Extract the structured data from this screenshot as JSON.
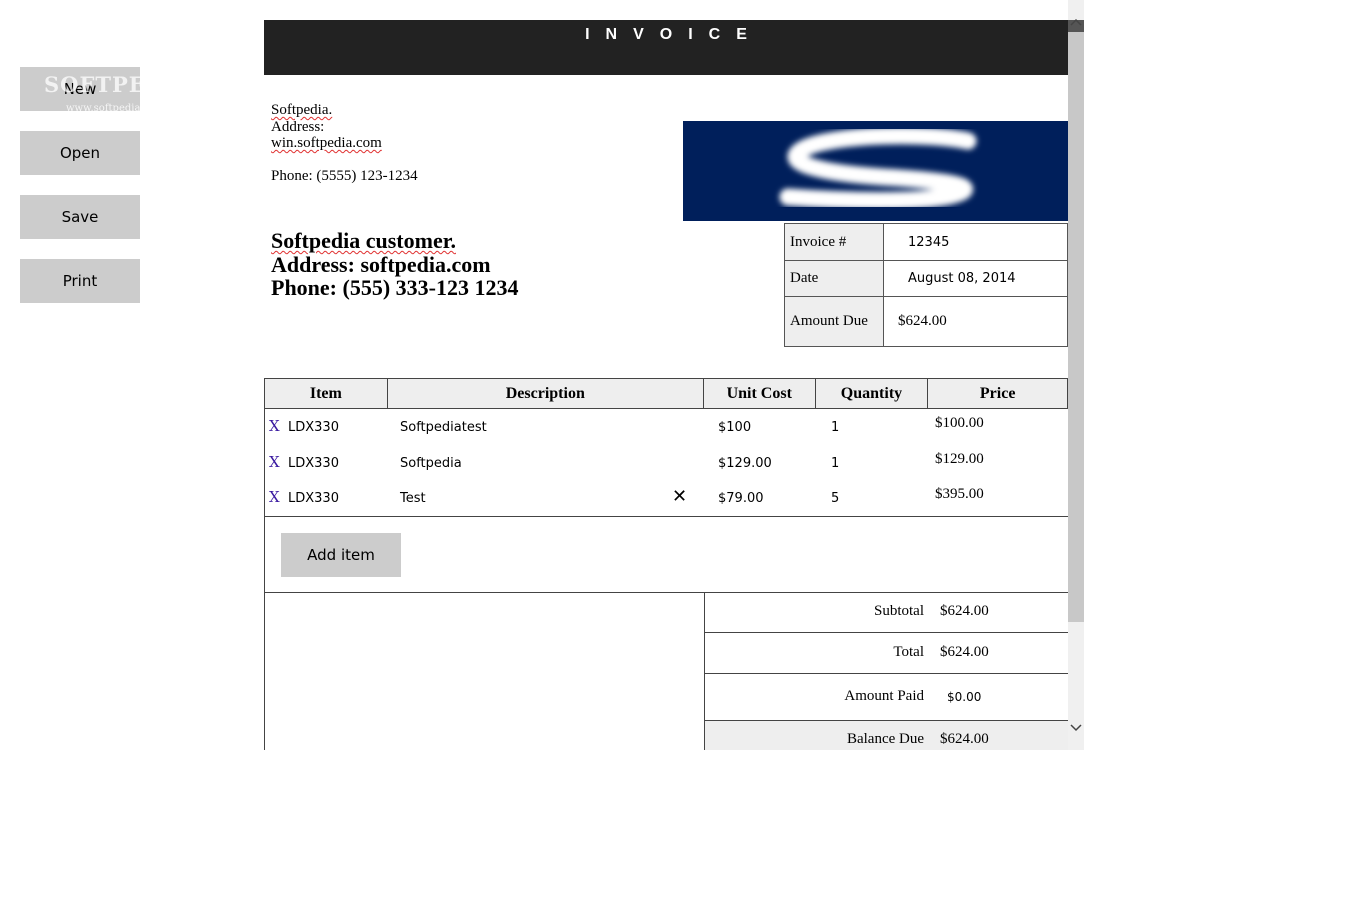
{
  "sidebar": {
    "buttons": [
      "New",
      "Open",
      "Save",
      "Print"
    ],
    "watermark": "SOFTPEDIA",
    "watermark_url": "www.softpedia.com"
  },
  "invoice": {
    "title": "INVOICE",
    "company": {
      "name": "Softpedia.",
      "address": "Address:",
      "website": "win.softpedia.com",
      "phone": "Phone: (5555) 123-1234"
    },
    "logo_letter": "S",
    "customer": {
      "name": "Softpedia customer.",
      "address": "Address: softpedia.com",
      "phone": "Phone: (555) 333-123 1234"
    },
    "meta": {
      "invoice_label": "Invoice #",
      "invoice_value": "12345",
      "date_label": "Date",
      "date_value": "August 08, 2014",
      "amount_due_label": "Amount Due",
      "amount_due_value": "$624.00"
    },
    "columns": [
      "Item",
      "Description",
      "Unit Cost",
      "Quantity",
      "Price"
    ],
    "rows": [
      {
        "item": "LDX330",
        "description": "Softpediatest",
        "unit_cost": "$100",
        "quantity": "1",
        "price": "$100.00"
      },
      {
        "item": "LDX330",
        "description": "Softpedia",
        "unit_cost": "$129.00",
        "quantity": "1",
        "price": "$129.00"
      },
      {
        "item": "LDX330",
        "description": "Test",
        "unit_cost": "$79.00",
        "quantity": "5",
        "price": "$395.00"
      }
    ],
    "delete_glyph": "X",
    "clear_glyph": "✕",
    "add_item_label": "Add item",
    "totals": {
      "subtotal_label": "Subtotal",
      "subtotal_value": "$624.00",
      "total_label": "Total",
      "total_value": "$624.00",
      "paid_label": "Amount Paid",
      "paid_value": "$0.00",
      "balance_label": "Balance Due",
      "balance_value": "$624.00"
    }
  },
  "colors": {
    "header_bg": "#222222",
    "logo_bg": "#001f5b",
    "button_bg": "#cccccc",
    "delete_glyph": "#3a1aa0"
  }
}
